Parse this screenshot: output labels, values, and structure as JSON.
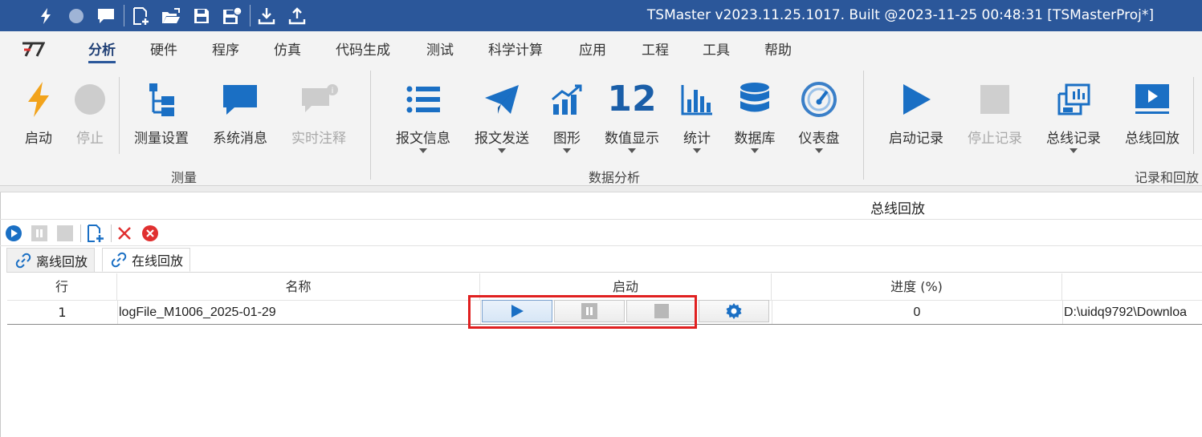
{
  "window": {
    "title": "TSMaster v2023.11.25.1017. Built @2023-11-25 00:48:31 [TSMasterProj*]"
  },
  "quick_access": [
    "bolt-icon",
    "record-dot-icon",
    "message-icon",
    "new-file-icon",
    "open-folder-icon",
    "save-icon",
    "save-as-icon",
    "import-icon",
    "export-icon"
  ],
  "menu": {
    "tabs": [
      "分析",
      "硬件",
      "程序",
      "仿真",
      "代码生成",
      "测试",
      "科学计算",
      "应用",
      "工程",
      "工具",
      "帮助"
    ],
    "active": "分析"
  },
  "ribbon": {
    "groups": {
      "measure": "测量",
      "analysis": "数据分析",
      "record": "记录和回放"
    },
    "buttons": {
      "start": "启动",
      "stop": "停止",
      "measure_setup": "测量设置",
      "system_msg": "系统消息",
      "realtime_comment": "实时注释",
      "msg_info": "报文信息",
      "msg_send": "报文发送",
      "graphics": "图形",
      "value_display": "数值显示",
      "statistics": "统计",
      "database": "数据库",
      "dashboard": "仪表盘",
      "start_record": "启动记录",
      "stop_record": "停止记录",
      "bus_record": "总线记录",
      "bus_replay": "总线回放"
    },
    "value_display_number": "12"
  },
  "panel": {
    "title": "总线回放",
    "tabs": {
      "offline": "离线回放",
      "online": "在线回放"
    },
    "grid": {
      "headers": {
        "row": "行",
        "name": "名称",
        "start": "启动",
        "progress": "进度 (%)"
      },
      "rows": [
        {
          "row": "1",
          "name": "logFile_M1006_2025-01-29",
          "progress": "0",
          "path": "D:\\uidq9792\\Downloa"
        }
      ]
    }
  },
  "colors": {
    "titlebar": "#2b579a",
    "accent": "#1a6fc4",
    "highlight": "#e02020",
    "delete": "#e03030"
  }
}
